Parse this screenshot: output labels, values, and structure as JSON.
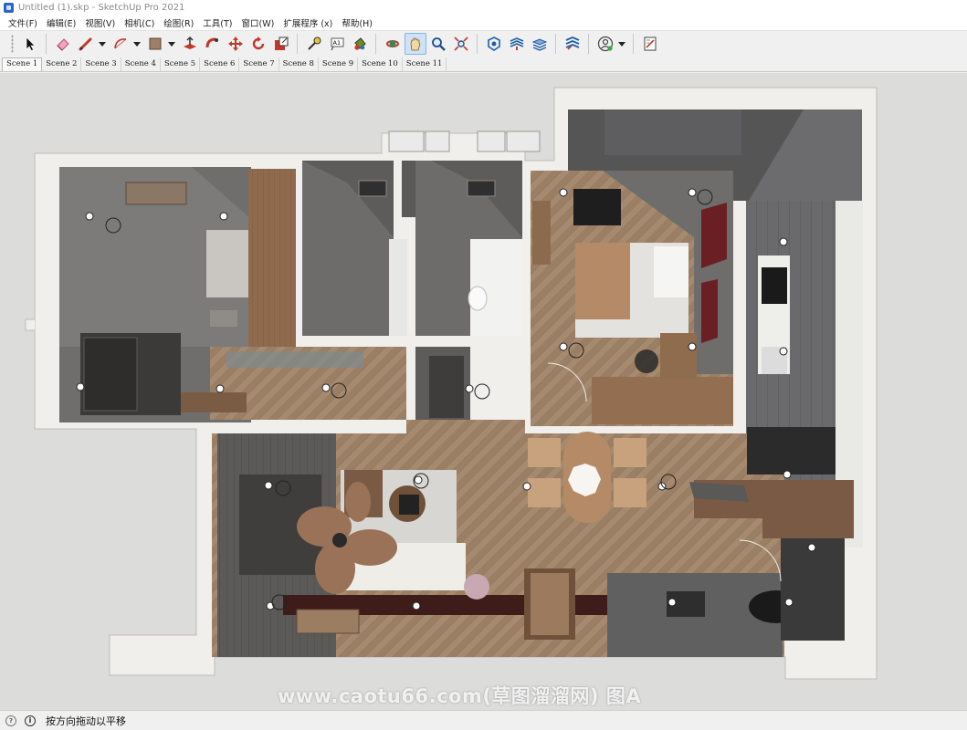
{
  "window": {
    "title": "Untitled (1).skp - SketchUp Pro 2021"
  },
  "menu": {
    "items": [
      "文件(F)",
      "编辑(E)",
      "视图(V)",
      "相机(C)",
      "绘图(R)",
      "工具(T)",
      "窗口(W)",
      "扩展程序 (x)",
      "帮助(H)"
    ]
  },
  "toolbar": {
    "tools": [
      {
        "name": "select-icon"
      },
      {
        "name": "eraser-icon"
      },
      {
        "name": "line-icon"
      },
      {
        "name": "arc-icon"
      },
      {
        "name": "rectangle-icon"
      },
      {
        "name": "push-pull-icon"
      },
      {
        "name": "follow-me-icon"
      },
      {
        "name": "move-icon"
      },
      {
        "name": "rotate-icon"
      },
      {
        "name": "scale-icon"
      },
      {
        "name": "tape-measure-icon"
      },
      {
        "name": "text-icon"
      },
      {
        "name": "paint-bucket-icon"
      },
      {
        "name": "orbit-icon"
      },
      {
        "name": "pan-icon",
        "active": true
      },
      {
        "name": "zoom-icon"
      },
      {
        "name": "zoom-extents-icon"
      },
      {
        "name": "3d-warehouse-icon"
      },
      {
        "name": "extension-warehouse-icon"
      },
      {
        "name": "layout-icon"
      },
      {
        "name": "extension-manager-icon"
      },
      {
        "name": "profile-icon"
      },
      {
        "name": "notes-icon"
      }
    ],
    "text_tool_label": "A1"
  },
  "scenes": {
    "active": "Scene 1",
    "tabs": [
      "Scene 1",
      "Scene 2",
      "Scene 3",
      "Scene 4",
      "Scene 5",
      "Scene 6",
      "Scene 7",
      "Scene 8",
      "Scene 9",
      "Scene 10",
      "Scene 11"
    ]
  },
  "viewport": {
    "watermark": "www.caotu66.com(草图溜溜网) 图A"
  },
  "status": {
    "message": "按方向拖动以平移"
  },
  "colors": {
    "accent": "#2b64c6",
    "active_tool": "#cfe3f8",
    "wall": "#f2f1ee",
    "floor_wood": "#a88b70",
    "dark_panel": "#5a5a5c"
  }
}
